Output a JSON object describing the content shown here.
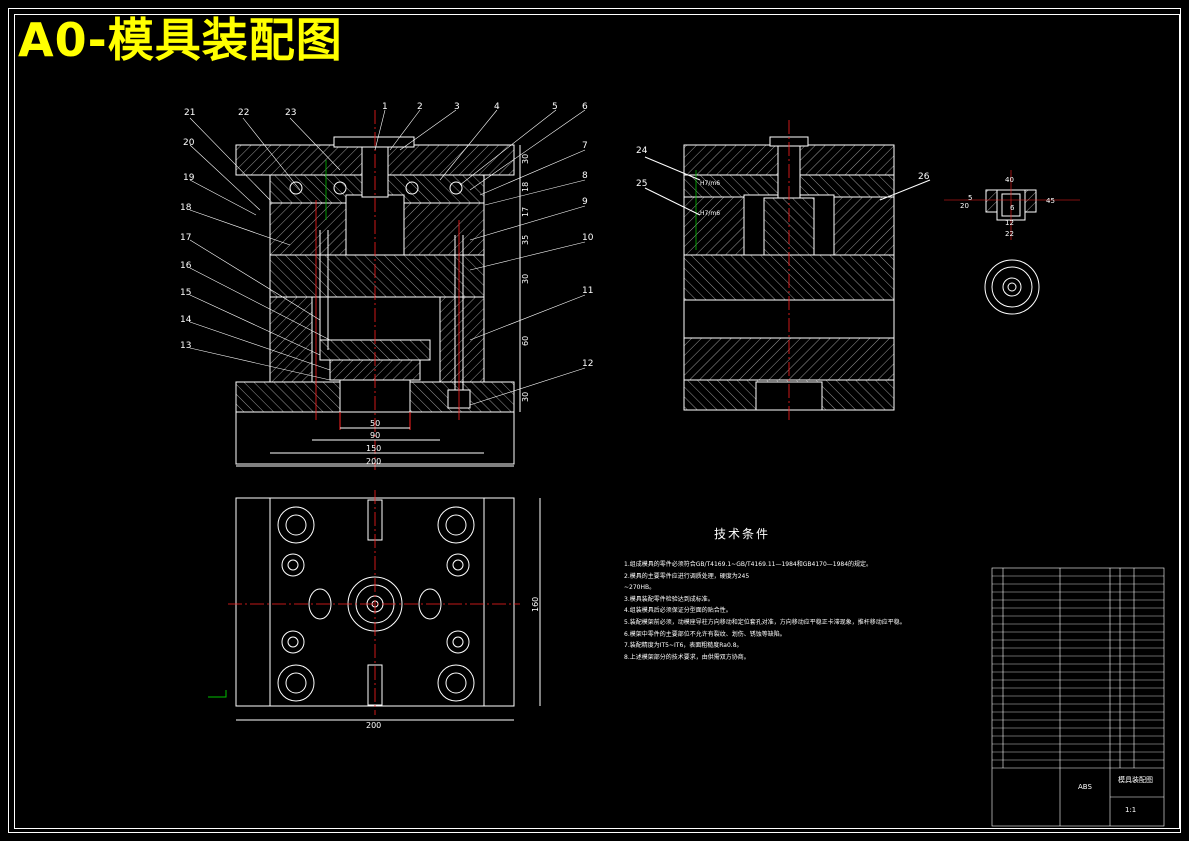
{
  "title": "A0-模具装配图",
  "technical_requirements": {
    "heading": "技术条件",
    "notes": [
      "1.组成模具的零件必须符合GB/T4169.1~GB/T4169.11—1984和GB4170—1984的规定。",
      "2.模具的主要零件应进行调质处理，硬度为245",
      "~270HB。",
      "3.模具装配零件检验达到成标准。",
      "4.组装模具后必须保证分型面的贴合性。",
      "5.装配模架前必须，动模座导柱方向移动和定位套孔对准，方向移动应平稳正卡滞现象，推杆移动应平稳。",
      "6.模架中零件的主要部位不允许有裂纹、划伤、锈蚀等缺陷。",
      "7.装配精度为IT5~IT6，表面粗糙度Ra0.8。",
      "8.上述模架部分的技术要求，由供需双方协商。"
    ]
  },
  "front_view": {
    "part_numbers": [
      "21",
      "22",
      "23",
      "1",
      "2",
      "3",
      "4",
      "5",
      "6",
      "7",
      "8",
      "9",
      "10",
      "11",
      "12",
      "20",
      "19",
      "18",
      "17",
      "16",
      "15",
      "14",
      "13"
    ],
    "height_dims": [
      "30",
      "18",
      "17",
      "35",
      "30",
      "60",
      "30"
    ],
    "width_dims": [
      "50",
      "90",
      "150",
      "200"
    ]
  },
  "side_view": {
    "part_numbers": [
      "24",
      "25",
      "26"
    ],
    "fits": [
      "H7/m6",
      "H7/m6"
    ]
  },
  "detail_view": {
    "dims": [
      "40",
      "20",
      "5",
      "6",
      "12",
      "22",
      "45"
    ]
  },
  "top_view": {
    "dims": [
      "160",
      "200"
    ]
  },
  "title_block": {
    "material": "ABS",
    "title_right": "模具装配图",
    "scale": "1:1"
  },
  "colors": {
    "outline": "#ffffff",
    "centerline": "#ff2020",
    "title": "#ffff00",
    "accent": "#00c000"
  }
}
